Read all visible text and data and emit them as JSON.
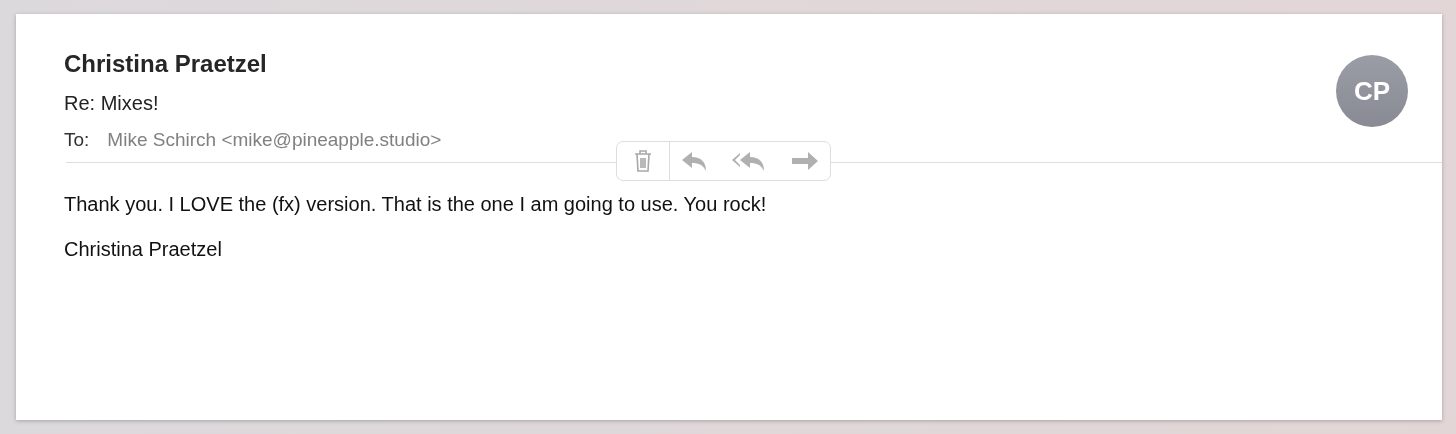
{
  "message": {
    "sender": "Christina Praetzel",
    "subject": "Re: Mixes!",
    "to_label": "To:",
    "to": "Mike Schirch <mike@pineapple.studio>",
    "avatar": "CP",
    "body": [
      "Thank you. I LOVE the (fx) version. That is the one I am going to use. You rock!",
      "Christina Praetzel"
    ]
  }
}
